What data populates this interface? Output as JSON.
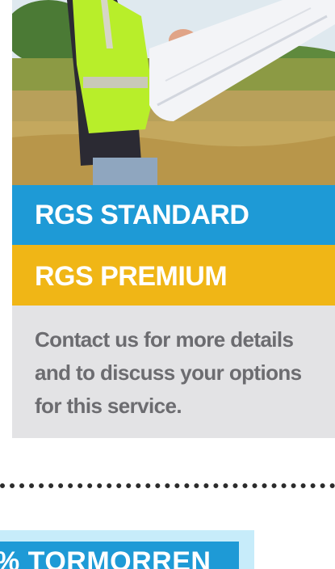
{
  "options": {
    "standard_label": "RGS STANDARD",
    "premium_label": "RGS PREMIUM"
  },
  "info": {
    "text": "Contact us for more details and to discuss your options for this service."
  },
  "bottom_tab": {
    "label": "% TORMORREN"
  },
  "colors": {
    "standard": "#1e9ad6",
    "premium": "#f0b616",
    "info_bg": "#e3e3e5",
    "info_text": "#6c6c70",
    "tab_light": "#c7ecfa"
  }
}
